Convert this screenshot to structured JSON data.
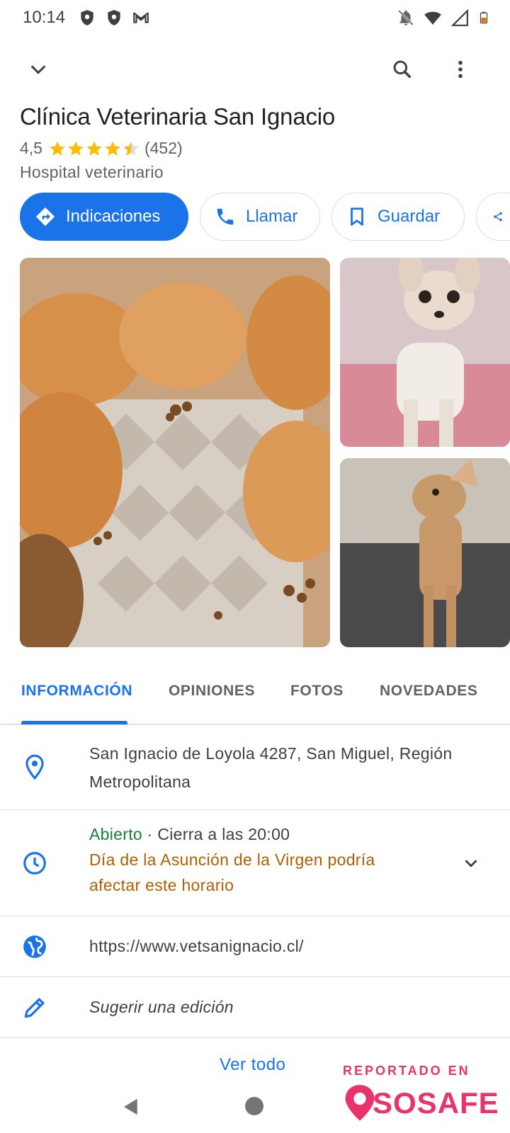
{
  "status_bar": {
    "time": "10:14",
    "left_icons": [
      "shield-icon",
      "shield-icon",
      "gmail-icon"
    ],
    "right_icons": [
      "notifications-off-icon",
      "wifi-icon",
      "signal-icon",
      "battery-icon"
    ]
  },
  "top_bar": {
    "icons": [
      "chevron-down-icon",
      "search-icon",
      "more-vert-icon"
    ]
  },
  "place": {
    "name": "Clínica Veterinaria San Ignacio",
    "rating": "4,5",
    "rating_value": 4.5,
    "reviews_count": "(452)",
    "category": "Hospital veterinario"
  },
  "actions": [
    {
      "label": "Indicaciones",
      "icon": "directions-icon"
    },
    {
      "label": "Llamar",
      "icon": "phone-icon"
    },
    {
      "label": "Guardar",
      "icon": "bookmark-icon"
    }
  ],
  "tabs": [
    {
      "label": "INFORMACIÓN",
      "active": true
    },
    {
      "label": "OPINIONES",
      "active": false
    },
    {
      "label": "FOTOS",
      "active": false
    },
    {
      "label": "NOVEDADES",
      "active": false
    }
  ],
  "info": {
    "address_line1": "San Ignacio de Loyola 4287, San Miguel, Región",
    "address_line2": "Metropolitana",
    "hours_status": "Abierto",
    "hours_detail": " · Cierra a las 20:00",
    "holiday_line1": "Día de la Asunción de la Virgen podría",
    "holiday_line2": "afectar este horario",
    "website": "https://www.vetsanignacio.cl/",
    "suggest_edit": "Sugerir una edición"
  },
  "see_all": "Ver todo",
  "watermark": {
    "label": "REPORTADO EN",
    "brand": "SOSAFE"
  },
  "colors": {
    "accent": "#1a73e8",
    "open": "#188038",
    "warning": "#b06000",
    "star": "#fbbc04",
    "watermark": "#e8336d"
  }
}
